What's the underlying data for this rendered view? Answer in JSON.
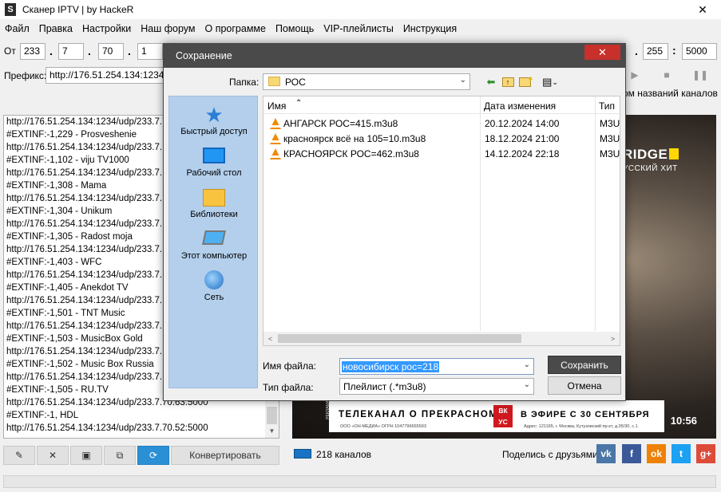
{
  "window": {
    "title": "Сканер IPTV | by HackeR",
    "app_icon": "S",
    "close_icon": "✕"
  },
  "menu": [
    "Файл",
    "Правка",
    "Настройки",
    "Наш форум",
    "О программе",
    "Помощь",
    "VIP-плейлисты",
    "Инструкция"
  ],
  "range": {
    "from_label": "От",
    "ip": [
      "233",
      "7",
      "70",
      "1"
    ],
    "to_end": "255",
    "port": "5000"
  },
  "prefix": {
    "label": "Префикс:",
    "value": "http://176.51.254.134:1234/udp/"
  },
  "names_label": "ом названий каналов",
  "playlist_lines": [
    "http://176.51.254.134:1234/udp/233.7.70.",
    "#EXTINF:-1,229 - Prosveshenie",
    "http://176.51.254.134:1234/udp/233.7.",
    "#EXTINF:-1,102 - viju TV1000",
    "http://176.51.254.134:1234/udp/233.7.",
    "#EXTINF:-1,308 - Mama",
    "http://176.51.254.134:1234/udp/233.7.",
    "#EXTINF:-1,304 - Unikum",
    "http://176.51.254.134:1234/udp/233.7.",
    "#EXTINF:-1,305 - Radost moja",
    "http://176.51.254.134:1234/udp/233.7.",
    "#EXTINF:-1,403 - WFC",
    "http://176.51.254.134:1234/udp/233.7.",
    "#EXTINF:-1,405 - Anekdot TV",
    "http://176.51.254.134:1234/udp/233.7.",
    "#EXTINF:-1,501 - TNT Music",
    "http://176.51.254.134:1234/udp/233.7.",
    "#EXTINF:-1,503 - MusicBox Gold",
    "http://176.51.254.134:1234/udp/233.7.",
    "#EXTINF:-1,502 - Music Box Russia",
    "http://176.51.254.134:1234/udp/233.7.",
    "#EXTINF:-1,505 - RU.TV",
    "http://176.51.254.134:1234/udp/233.7.70.63:5000",
    "#EXTINF:-1, HDL",
    "http://176.51.254.134:1234/udp/233.7.70.52:5000"
  ],
  "video": {
    "brand": "RIDGE",
    "brand_sub": "УССКИЙ ХИТ",
    "ad_main": "ТЕЛЕКАНАЛ О ПРЕКРАСНОМ",
    "ad_logo": "ВК\nУС",
    "ad_right": "В ЭФИРЕ С 30 СЕНТЯБРЯ",
    "ad_small": "ООО «ОН-МЕДИА» ОГРН 1047796665593",
    "ad_small2": "Адрес: 121165, г. Москва, Кутузовский пр-кт, д.35/30, с.1",
    "vertical_tag": "РЕКЛАМА",
    "clock": "10:56"
  },
  "toolbar": {
    "convert_label": "Конвертировать"
  },
  "channels_label": "218 каналов",
  "share_label": "Поделись с друзьями:",
  "social": [
    {
      "name": "vk-icon",
      "glyph": "vk",
      "color": "#4a76a8"
    },
    {
      "name": "facebook-icon",
      "glyph": "f",
      "color": "#3b5998"
    },
    {
      "name": "odnoklassniki-icon",
      "glyph": "ok",
      "color": "#ee8208"
    },
    {
      "name": "twitter-icon",
      "glyph": "t",
      "color": "#1da1f2"
    },
    {
      "name": "googleplus-icon",
      "glyph": "g+",
      "color": "#dd4b39"
    }
  ],
  "dialog": {
    "title": "Сохранение",
    "close_icon": "✕",
    "folder_label": "Папка:",
    "folder_value": "РОС",
    "places": [
      "Быстрый доступ",
      "Рабочий стол",
      "Библиотеки",
      "Этот компьютер",
      "Сеть"
    ],
    "columns": {
      "name": "Имя",
      "date": "Дата изменения",
      "type": "Тип"
    },
    "files": [
      {
        "name": "АНГАРСК РОС=415.m3u8",
        "date": "20.12.2024 14:00",
        "type": "M3U8"
      },
      {
        "name": "красноярск всё на 105=10.m3u8",
        "date": "18.12.2024 21:00",
        "type": "M3U8"
      },
      {
        "name": "КРАСНОЯРСК РОС=462.m3u8",
        "date": "14.12.2024 22:18",
        "type": "M3U8"
      }
    ],
    "filename_label": "Имя файла:",
    "filename_value": "новосибирск рос=218",
    "filetype_label": "Тип файла:",
    "filetype_value": "Плейлист (.*m3u8)",
    "save_label": "Сохранить",
    "cancel_label": "Отмена"
  }
}
